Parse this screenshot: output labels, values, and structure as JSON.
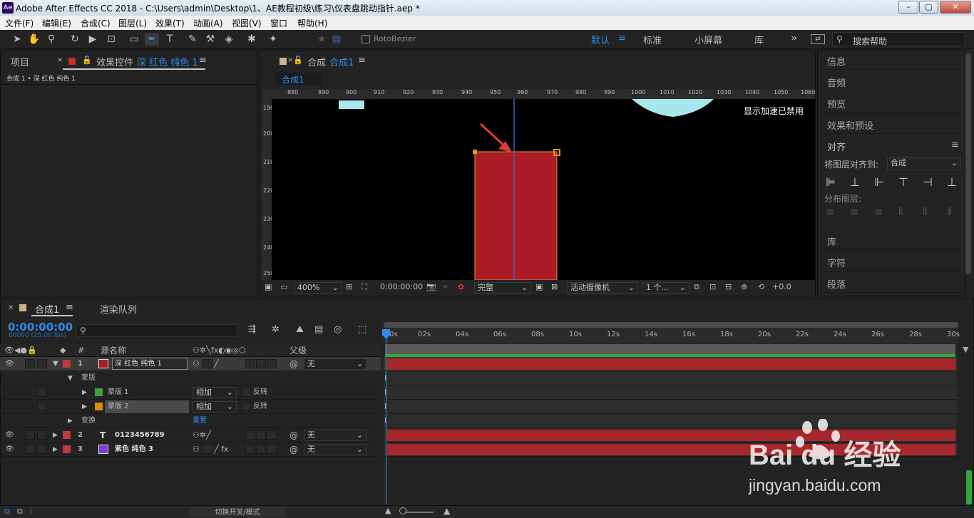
{
  "titlebar": {
    "title": "Adobe After Effects CC 2018 - C:\\Users\\admin\\Desktop\\1、AE教程初级\\练习\\仪表盘跳动指针.aep *",
    "app_icon": "Ae",
    "min": "–",
    "max": "▢",
    "close": "✕"
  },
  "menu": [
    "文件(F)",
    "编辑(E)",
    "合成(C)",
    "图层(L)",
    "效果(T)",
    "动画(A)",
    "视图(V)",
    "窗口",
    "帮助(H)"
  ],
  "toolbar": {
    "rotobezier": "RotoBezier",
    "workspaces": [
      "默认",
      "标准",
      "小屏幕",
      "库"
    ],
    "more": "»",
    "search_placeholder": "搜索帮助",
    "active_workspace_color": "#2d8ceb"
  },
  "left_panel": {
    "tab_project": "项目",
    "tab_effects_prefix": "效果控件",
    "tab_effects_layer": "深 红色 纯色 1",
    "breadcrumb": "合成 1 • 深 红色 纯色 1"
  },
  "comp_panel": {
    "tab_prefix": "合成",
    "tab_name": "合成1",
    "sub_tab": "合成1",
    "ruler_labels": [
      "880",
      "890",
      "900",
      "910",
      "920",
      "930",
      "940",
      "950",
      "960",
      "970",
      "980",
      "990",
      "1000",
      "1010",
      "1020",
      "1030",
      "1040",
      "1050",
      "1060"
    ],
    "v_ruler_labels": [
      "190",
      "200",
      "210",
      "220",
      "230",
      "240",
      "250"
    ],
    "notice": "显示加速已禁用",
    "zoom": "400%",
    "timecode": "0:00:00:00",
    "resolution": "完整",
    "camera": "活动摄像机",
    "views": "1 个...",
    "exposure": "+0.0",
    "red_layer_color": "#ab1c27"
  },
  "right_panel": {
    "items": [
      "信息",
      "音频",
      "预览",
      "效果和预设"
    ],
    "align_title": "对齐",
    "align_to_label": "将图层对齐到:",
    "align_to_value": "合成",
    "distribute_label": "分布图层:",
    "items_bottom": [
      "库",
      "字符",
      "段落"
    ]
  },
  "timeline": {
    "tab": "合成1",
    "tab_render": "渲染队列",
    "timecode": "0:00:00:00",
    "fps": "00000 (25.00 fps)",
    "col_num": "#",
    "col_source": "源名称",
    "col_parent": "父级",
    "switches": "切换开关/模式",
    "ruler": [
      "0s",
      "02s",
      "04s",
      "06s",
      "08s",
      "10s",
      "12s",
      "14s",
      "16s",
      "18s",
      "20s",
      "22s",
      "24s",
      "26s",
      "28s",
      "30s"
    ],
    "layers": [
      {
        "num": "1",
        "name": "深 红色 纯色 1",
        "color": "#ab1c27",
        "parent": "无"
      },
      {
        "num": "2",
        "name": "0123456789",
        "color": "#c23a3a",
        "parent": "无",
        "type_icon": "T"
      },
      {
        "num": "3",
        "name": "紫色 纯色 3",
        "color": "#7e3cd8",
        "parent": "无"
      }
    ],
    "mask_group": "蒙版",
    "transform_group": "变换",
    "reset": "重置",
    "masks": [
      {
        "name": "蒙版 1",
        "mode": "相加",
        "invert": "反转",
        "color": "#3aa243"
      },
      {
        "name": "蒙版 2",
        "mode": "相加",
        "invert": "反转",
        "color": "#e08a10"
      }
    ]
  },
  "watermark": {
    "logo": "Bai du 经验",
    "url": "jingyan.baidu.com"
  }
}
